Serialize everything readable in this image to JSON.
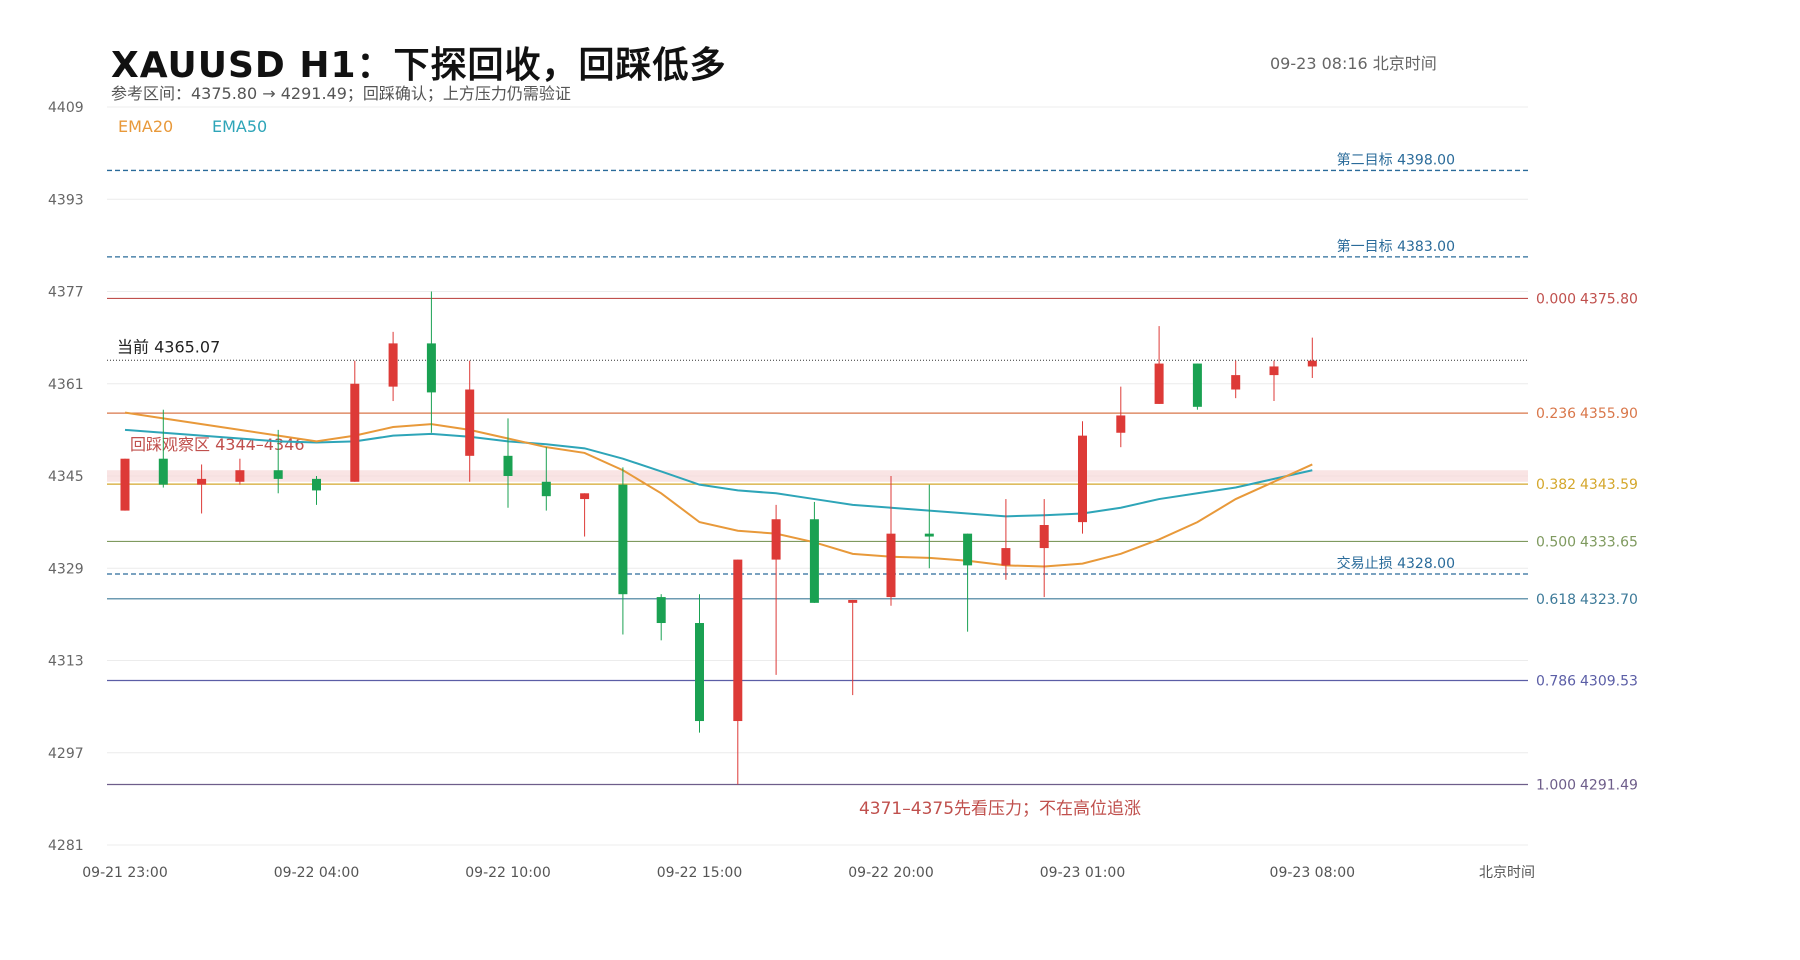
{
  "header": {
    "title": "XAUUSD  H1：下探回收，回踩低多",
    "subtitle": "参考区间：4375.80 → 4291.49；回踩确认；上方压力仍需验证",
    "timestamp": "09-23  08:16 北京时间"
  },
  "legend": [
    {
      "name": "EMA20",
      "color": "#e8993a"
    },
    {
      "name": "EMA50",
      "color": "#2ea5b8"
    }
  ],
  "chart_data": {
    "type": "candlestick",
    "title": "XAUUSD  H1：下探回收，回踩低多",
    "ylim": [
      4281,
      4409
    ],
    "yticks": [
      4409,
      4393,
      4377,
      4361,
      4345,
      4329,
      4313,
      4297,
      4281
    ],
    "x_axis_label": "北京时间",
    "xticks": [
      {
        "index": 0,
        "label": "09-21 23:00"
      },
      {
        "index": 5,
        "label": "09-22 04:00"
      },
      {
        "index": 10,
        "label": "09-22 10:00"
      },
      {
        "index": 15,
        "label": "09-22 15:00"
      },
      {
        "index": 20,
        "label": "09-22 20:00"
      },
      {
        "index": 25,
        "label": "09-23 01:00"
      },
      {
        "index": 31,
        "label": "09-23 08:00"
      }
    ],
    "x_count": 37,
    "candles": [
      {
        "o": 4348.0,
        "h": 4348.0,
        "c": 4339.0,
        "l": 4339.0
      },
      {
        "o": 4343.5,
        "h": 4356.5,
        "c": 4348.0,
        "l": 4343.0
      },
      {
        "o": 4344.5,
        "h": 4347.0,
        "c": 4343.5,
        "l": 4338.5
      },
      {
        "o": 4346.0,
        "h": 4348.0,
        "c": 4344.0,
        "l": 4343.5
      },
      {
        "o": 4344.5,
        "h": 4353.0,
        "c": 4346.0,
        "l": 4342.0
      },
      {
        "o": 4342.5,
        "h": 4345.0,
        "c": 4344.5,
        "l": 4340.0
      },
      {
        "o": 4361.0,
        "h": 4365.0,
        "c": 4344.0,
        "l": 4344.0
      },
      {
        "o": 4368.0,
        "h": 4370.0,
        "c": 4360.5,
        "l": 4358.0
      },
      {
        "o": 4359.5,
        "h": 4377.0,
        "c": 4368.0,
        "l": 4352.5
      },
      {
        "o": 4360.0,
        "h": 4365.0,
        "c": 4348.5,
        "l": 4344.0
      },
      {
        "o": 4345.0,
        "h": 4355.0,
        "c": 4348.5,
        "l": 4339.5
      },
      {
        "o": 4341.5,
        "h": 4350.0,
        "c": 4344.0,
        "l": 4339.0
      },
      {
        "o": 4342.0,
        "h": 4342.0,
        "c": 4341.0,
        "l": 4334.5
      },
      {
        "o": 4324.5,
        "h": 4346.5,
        "c": 4343.5,
        "l": 4317.5
      },
      {
        "o": 4319.5,
        "h": 4324.5,
        "c": 4324.0,
        "l": 4316.5
      },
      {
        "o": 4302.5,
        "h": 4324.5,
        "c": 4319.5,
        "l": 4300.5
      },
      {
        "o": 4330.5,
        "h": 4330.5,
        "c": 4302.5,
        "l": 4291.5
      },
      {
        "o": 4337.5,
        "h": 4340.0,
        "c": 4330.5,
        "l": 4310.5
      },
      {
        "o": 4323.0,
        "h": 4340.5,
        "c": 4337.5,
        "l": 4323.0
      },
      {
        "o": 4323.5,
        "h": 4323.5,
        "c": 4323.0,
        "l": 4307.0
      },
      {
        "o": 4335.0,
        "h": 4345.0,
        "c": 4324.0,
        "l": 4322.5
      },
      {
        "o": 4334.5,
        "h": 4343.5,
        "c": 4335.0,
        "l": 4329.0
      },
      {
        "o": 4329.5,
        "h": 4335.0,
        "c": 4335.0,
        "l": 4318.0
      },
      {
        "o": 4332.5,
        "h": 4341.0,
        "c": 4329.5,
        "l": 4327.0
      },
      {
        "o": 4336.5,
        "h": 4341.0,
        "c": 4332.5,
        "l": 4324.0
      },
      {
        "o": 4352.0,
        "h": 4354.5,
        "c": 4337.0,
        "l": 4335.0
      },
      {
        "o": 4355.5,
        "h": 4360.5,
        "c": 4352.5,
        "l": 4350.0
      },
      {
        "o": 4364.5,
        "h": 4371.0,
        "c": 4357.5,
        "l": 4357.5
      },
      {
        "o": 4357.0,
        "h": 4364.5,
        "c": 4364.5,
        "l": 4356.5
      },
      {
        "o": 4362.5,
        "h": 4365.0,
        "c": 4360.0,
        "l": 4358.5
      },
      {
        "o": 4364.0,
        "h": 4365.0,
        "c": 4362.5,
        "l": 4358.0
      },
      {
        "o": 4365.0,
        "h": 4369.0,
        "c": 4364.0,
        "l": 4362.0
      }
    ],
    "ema20": [
      4356.0,
      4355.0,
      4354.0,
      4353.0,
      4352.0,
      4351.0,
      4352.0,
      4353.5,
      4354.0,
      4353.0,
      4351.5,
      4350.0,
      4349.0,
      4346.0,
      4342.0,
      4337.0,
      4335.5,
      4335.0,
      4333.5,
      4331.5,
      4331.0,
      4330.8,
      4330.3,
      4329.5,
      4329.3,
      4329.8,
      4331.5,
      4334.0,
      4337.0,
      4341.0,
      4344.0,
      4347.0
    ],
    "ema50": [
      4353.0,
      4352.5,
      4352.0,
      4351.5,
      4351.0,
      4350.8,
      4351.0,
      4352.0,
      4352.3,
      4351.8,
      4351.0,
      4350.5,
      4349.8,
      4348.0,
      4345.8,
      4343.5,
      4342.5,
      4342.0,
      4341.0,
      4340.0,
      4339.5,
      4339.0,
      4338.5,
      4338.0,
      4338.2,
      4338.5,
      4339.5,
      4341.0,
      4342.0,
      4343.0,
      4344.5,
      4346.0
    ],
    "fib_levels": [
      {
        "ratio": "0.000",
        "price": "4375.80",
        "value": 4375.8,
        "color": "#c0504d"
      },
      {
        "ratio": "0.236",
        "price": "4355.90",
        "value": 4355.9,
        "color": "#d9774a"
      },
      {
        "ratio": "0.382",
        "price": "4343.59",
        "value": 4343.59,
        "color": "#d4a72c"
      },
      {
        "ratio": "0.500",
        "price": "4333.65",
        "value": 4333.65,
        "color": "#7f9a5f"
      },
      {
        "ratio": "0.618",
        "price": "4323.70",
        "value": 4323.7,
        "color": "#3d7a99"
      },
      {
        "ratio": "0.786",
        "price": "4309.53",
        "value": 4309.53,
        "color": "#5b5ea6"
      },
      {
        "ratio": "1.000",
        "price": "4291.49",
        "value": 4291.49,
        "color": "#6e5e8a"
      }
    ],
    "targets": [
      {
        "label": "第二目标 4398.00",
        "value": 4398.0
      },
      {
        "label": "第一目标 4383.00",
        "value": 4383.0
      },
      {
        "label": "交易止损 4328.00",
        "value": 4328.0
      }
    ],
    "current": {
      "label": "当前 4365.07",
      "value": 4365.07
    },
    "zone": {
      "label": "回踩观察区  4344–4346",
      "low": 4344,
      "high": 4346
    },
    "note": "4371–4375先看压力；不在高位追涨",
    "colors": {
      "up": "#1aa152",
      "down": "#dd3a37",
      "target_line": "#2a6b9a",
      "zone": "#f7d8d8"
    }
  }
}
